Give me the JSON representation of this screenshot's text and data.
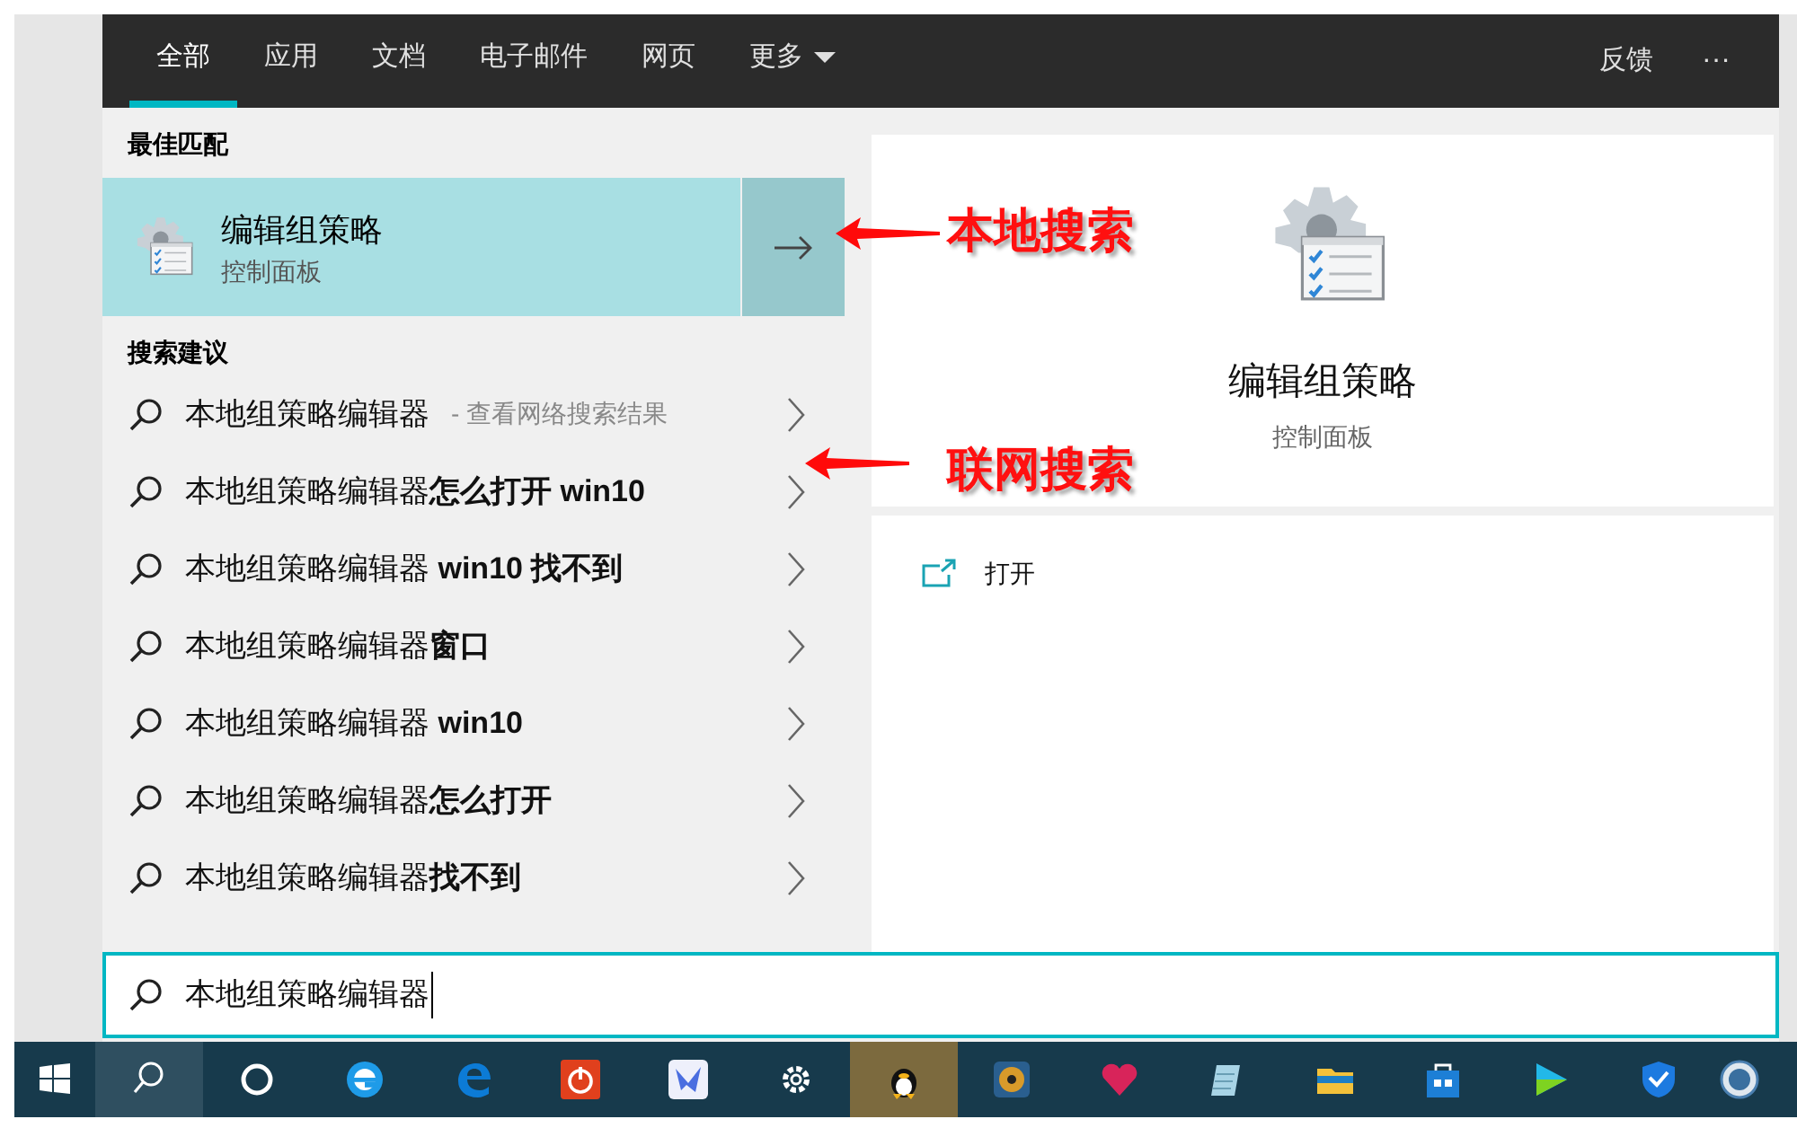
{
  "tabs": [
    {
      "label": "全部",
      "selected": true,
      "dropdown": false
    },
    {
      "label": "应用",
      "selected": false,
      "dropdown": false
    },
    {
      "label": "文档",
      "selected": false,
      "dropdown": false
    },
    {
      "label": "电子邮件",
      "selected": false,
      "dropdown": false
    },
    {
      "label": "网页",
      "selected": false,
      "dropdown": false
    },
    {
      "label": "更多",
      "selected": false,
      "dropdown": true
    }
  ],
  "header_actions": {
    "feedback": "反馈",
    "more": "···"
  },
  "best_match": {
    "heading": "最佳匹配",
    "title": "编辑组策略",
    "subtitle": "控制面板"
  },
  "suggestions": {
    "heading": "搜索建议",
    "items": [
      {
        "text": "本地组策略编辑器",
        "hint": "- 查看网络搜索结果"
      },
      {
        "text": "本地组策略编辑器**怎么打开 win10**"
      },
      {
        "text": "本地组策略编辑器 **win10 找不到**"
      },
      {
        "text": "本地组策略编辑器**窗口**"
      },
      {
        "text": "本地组策略编辑器 **win10**"
      },
      {
        "text": "本地组策略编辑器**怎么打开**"
      },
      {
        "text": "本地组策略编辑器**找不到**"
      }
    ]
  },
  "preview": {
    "title": "编辑组策略",
    "subtitle": "控制面板",
    "actions": [
      {
        "label": "打开"
      }
    ]
  },
  "search_box": {
    "value": "本地组策略编辑器"
  },
  "annotations": [
    {
      "text": "本地搜索"
    },
    {
      "text": "联网搜索"
    }
  ],
  "taskbar": [
    {
      "kind": "start",
      "selected": false,
      "attention": false
    },
    {
      "kind": "search",
      "selected": true,
      "attention": false
    },
    {
      "kind": "cortana",
      "selected": false,
      "attention": false
    },
    {
      "kind": "ie",
      "selected": false,
      "attention": false
    },
    {
      "kind": "edge",
      "selected": false,
      "attention": false
    },
    {
      "kind": "power",
      "selected": false,
      "attention": false
    },
    {
      "kind": "bird",
      "selected": false,
      "attention": false
    },
    {
      "kind": "gear",
      "selected": false,
      "attention": false
    },
    {
      "kind": "penguin",
      "selected": false,
      "attention": true
    },
    {
      "kind": "media",
      "selected": false,
      "attention": false
    },
    {
      "kind": "heart",
      "selected": false,
      "attention": false
    },
    {
      "kind": "notepad",
      "selected": false,
      "attention": false
    },
    {
      "kind": "folder",
      "selected": false,
      "attention": false
    },
    {
      "kind": "store",
      "selected": false,
      "attention": false
    },
    {
      "kind": "video",
      "selected": false,
      "attention": false
    },
    {
      "kind": "shield",
      "selected": false,
      "attention": false
    },
    {
      "kind": "globe",
      "selected": false,
      "attention": false
    }
  ]
}
